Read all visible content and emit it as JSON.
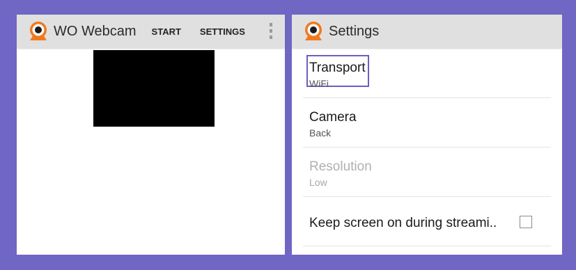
{
  "left_panel": {
    "app_icon": "webcam-eye-icon",
    "title": "WO Webcam",
    "actions": {
      "start_label": "START",
      "settings_label": "SETTINGS"
    },
    "overflow_icon": "more-vert-icon"
  },
  "right_panel": {
    "app_icon": "webcam-eye-icon",
    "title": "Settings",
    "preferences": [
      {
        "title": "Transport",
        "summary": "WiFi",
        "enabled": true,
        "focused": true
      },
      {
        "title": "Camera",
        "summary": "Back",
        "enabled": true,
        "focused": false
      },
      {
        "title": "Resolution",
        "summary": "Low",
        "enabled": false,
        "focused": false
      },
      {
        "title": "Keep screen on during streami..",
        "checked": false
      }
    ]
  },
  "colors": {
    "background": "#7066c3",
    "actionbar": "#e0e0e0",
    "icon_orange": "#f0791e",
    "focus_outline": "#6a5fc1"
  }
}
